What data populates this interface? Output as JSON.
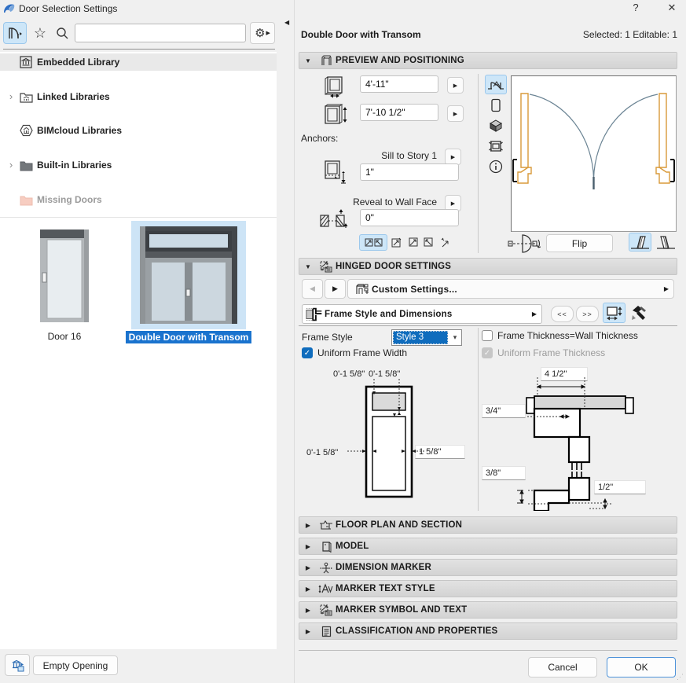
{
  "window": {
    "title": "Door Selection Settings"
  },
  "icons": {
    "help": "?",
    "close": "✕",
    "star": "☆",
    "gear": "⚙",
    "chevron_right": "▶",
    "chevron_left": "◀",
    "chevron_down": "▼",
    "select_chevron": "▾",
    "expand": "›",
    "collapse_panel": "◀",
    "check": "✓",
    "prev_page": "<<",
    "next_page": ">>"
  },
  "left_panel": {
    "search_value": "",
    "tree": [
      {
        "label": "Embedded Library"
      },
      {
        "label": "Linked Libraries"
      },
      {
        "label": "BIMcloud Libraries"
      },
      {
        "label": "Built-in Libraries"
      },
      {
        "label": "Missing Doors"
      }
    ],
    "thumbnails": [
      {
        "label": "Door 16"
      },
      {
        "label": "Double Door with Transom"
      }
    ],
    "empty_opening_label": "Empty Opening"
  },
  "header": {
    "title": "Double Door with Transom",
    "selection_status": "Selected: 1 Editable: 1"
  },
  "preview_positioning": {
    "section_label": "PREVIEW AND POSITIONING",
    "width_value": "4'-11\"",
    "height_value": "7'-10 1/2\"",
    "anchors_label": "Anchors:",
    "sill_label": "Sill to Story 1",
    "sill_value": "1\"",
    "reveal_label": "Reveal to Wall Face",
    "reveal_value": "0\"",
    "flip_label": "Flip"
  },
  "hinged_door_settings": {
    "section_label": "HINGED DOOR SETTINGS",
    "custom_settings_label": "Custom Settings...",
    "panel_title": "Frame Style and Dimensions",
    "frame_style_label": "Frame Style",
    "frame_style_value": "Style 3",
    "uniform_frame_width_label": "Uniform Frame Width",
    "frame_thickness_label": "Frame Thickness=Wall Thickness",
    "uniform_frame_thickness_label": "Uniform Frame Thickness",
    "dims": {
      "top_left": "0'-1 5/8\"",
      "top_right": "0'-1 5/8\"",
      "left": "0'-1 5/8\"",
      "leaf_frame": "1 5/8\"",
      "head_width": "4 1/2\"",
      "stop_width": "3/4\"",
      "stop_depth": "3/8\"",
      "clearance": "1/2\""
    }
  },
  "collapsed_sections": [
    {
      "label": "FLOOR PLAN AND SECTION"
    },
    {
      "label": "MODEL"
    },
    {
      "label": "DIMENSION MARKER"
    },
    {
      "label": "MARKER TEXT STYLE"
    },
    {
      "label": "MARKER SYMBOL AND TEXT"
    },
    {
      "label": "CLASSIFICATION AND PROPERTIES"
    }
  ],
  "footer": {
    "cancel_label": "Cancel",
    "ok_label": "OK"
  }
}
